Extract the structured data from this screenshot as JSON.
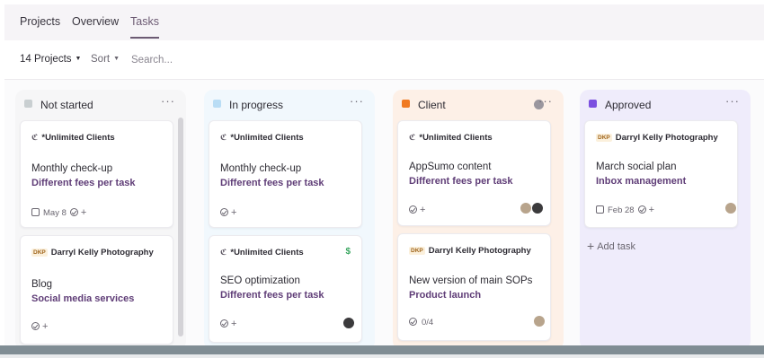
{
  "tabs": [
    "Projects",
    "Overview",
    "Tasks"
  ],
  "filters": {
    "projects": "14 Projects",
    "sort": "Sort",
    "search_placeholder": "Search..."
  },
  "columns": [
    {
      "title": "Not started",
      "color": "#c9cfd1",
      "bg": "#f6f6f7",
      "cards": [
        {
          "client": "*Unlimited Clients",
          "task": "Monthly check-up",
          "service": "Different fees per task",
          "date": "May 8"
        },
        {
          "client": "Darryl Kelly Photography",
          "task": "Blog",
          "service": "Social media services"
        }
      ]
    },
    {
      "title": "In progress",
      "color": "#b9ddf5",
      "bg": "#f1f8fd",
      "cards": [
        {
          "client": "*Unlimited Clients",
          "task": "Monthly check-up",
          "service": "Different fees per task"
        },
        {
          "client": "*Unlimited Clients",
          "task": "SEO optimization",
          "service": "Different fees per task"
        }
      ]
    },
    {
      "title": "Client",
      "color": "#f07a22",
      "bg": "#fdf0e7",
      "cards": [
        {
          "client": "*Unlimited Clients",
          "task": "AppSumo content",
          "service": "Different fees per task"
        },
        {
          "client": "Darryl Kelly Photography",
          "task": "New version of main SOPs",
          "service": "Product launch",
          "checklist": "0/4"
        }
      ]
    },
    {
      "title": "Approved",
      "color": "#7b4fe0",
      "bg": "#efecfb",
      "cards": [
        {
          "client": "Darryl Kelly Photography",
          "task": "March social plan",
          "service": "Inbox management",
          "date": "Feb 28"
        }
      ],
      "add_task": "Add task"
    }
  ],
  "icons": {
    "more": "ellipsis-icon",
    "check": "check-circle-icon",
    "calendar": "calendar-icon",
    "plus": "plus-icon",
    "dollar": "dollar-icon"
  },
  "logo_marks": {
    "unlimited": "ℭ",
    "dkp": "DKP"
  },
  "glyphs": {
    "more": "···",
    "plus": "+",
    "dollar": "$",
    "caret": "▼"
  }
}
